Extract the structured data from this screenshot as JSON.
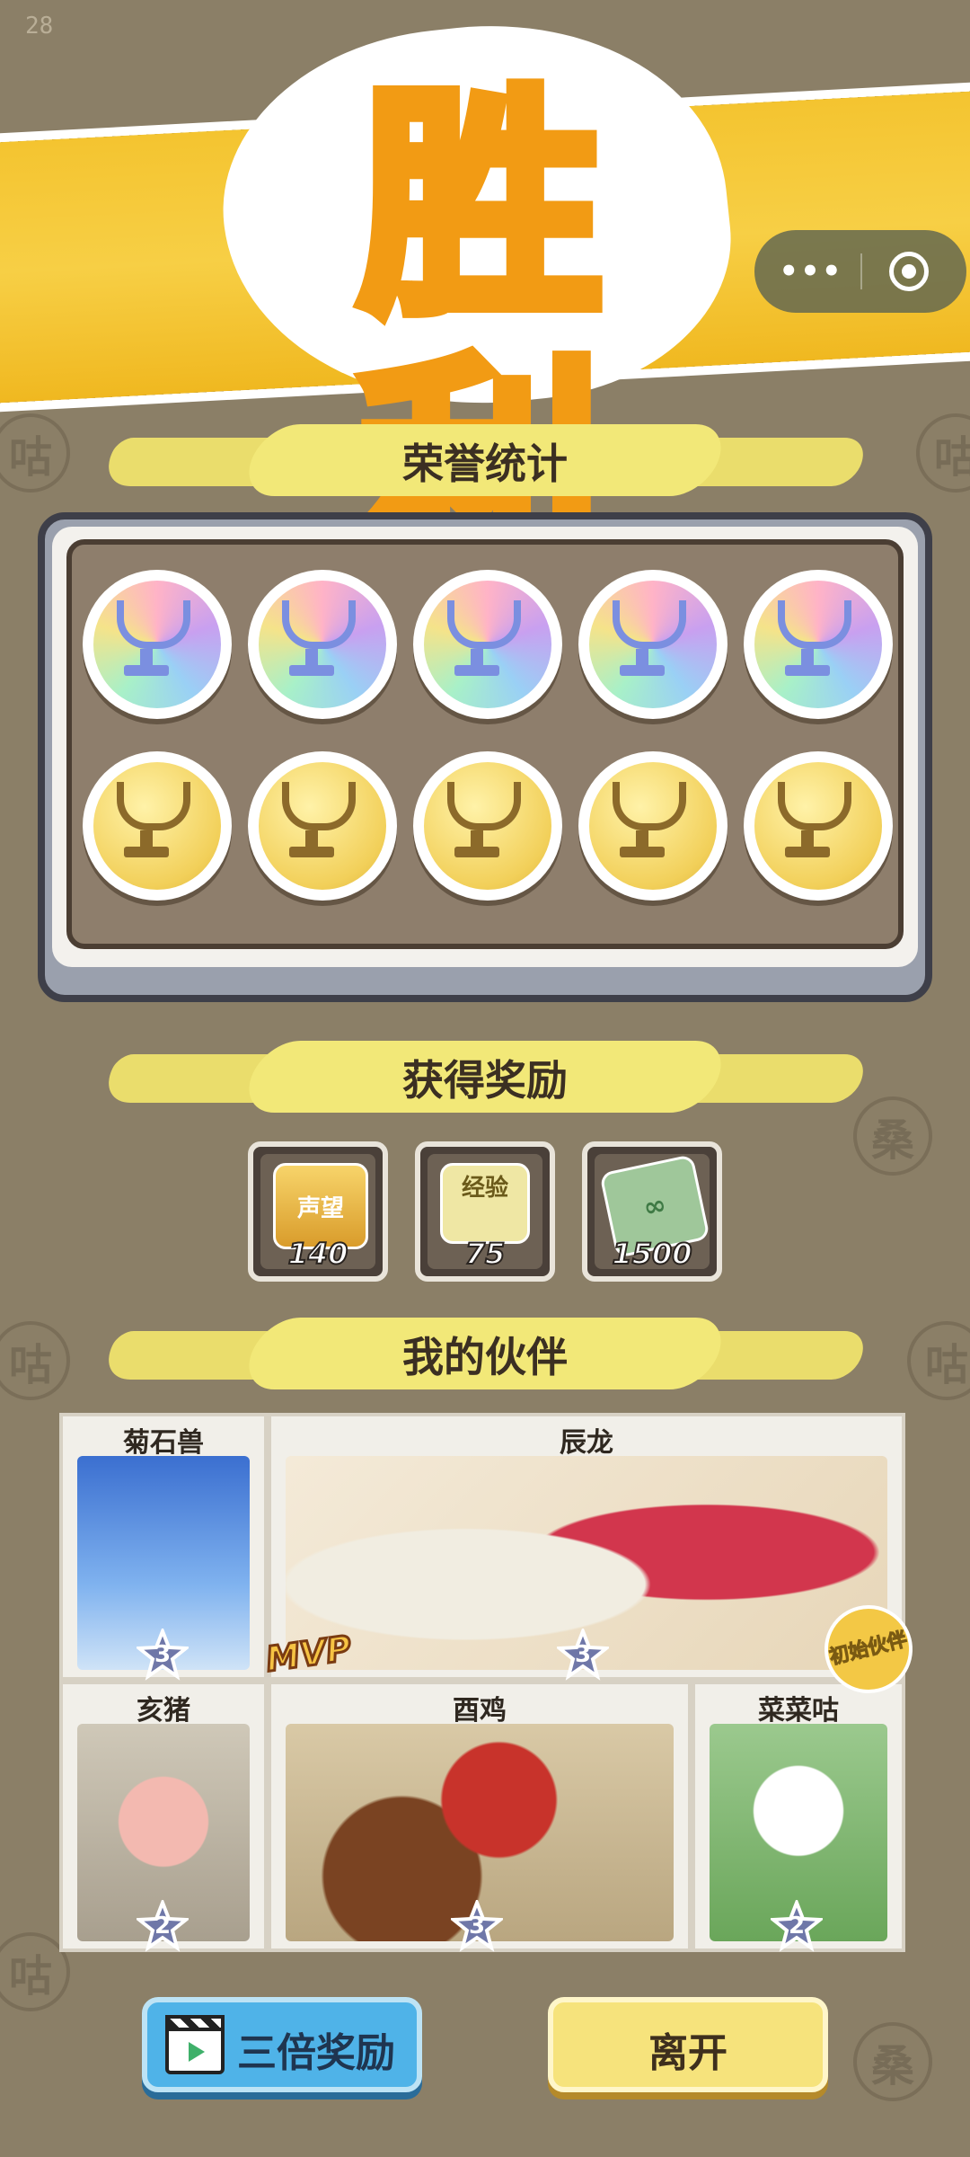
{
  "status": {
    "fps": "28"
  },
  "banner": {
    "title": "胜利"
  },
  "sections": {
    "honor": "荣誉统计",
    "rewards": "获得奖励",
    "partners": "我的伙伴"
  },
  "honor": {
    "medals": [
      {
        "type": "rainbow"
      },
      {
        "type": "rainbow"
      },
      {
        "type": "rainbow"
      },
      {
        "type": "rainbow"
      },
      {
        "type": "rainbow"
      },
      {
        "type": "gold"
      },
      {
        "type": "gold"
      },
      {
        "type": "gold"
      },
      {
        "type": "gold"
      },
      {
        "type": "gold"
      }
    ]
  },
  "rewards": [
    {
      "icon": "reputation-badge-icon",
      "tag": "声望",
      "count": "140"
    },
    {
      "icon": "experience-dino-icon",
      "tag": "经验",
      "count": "75"
    },
    {
      "icon": "banknote-icon",
      "tag": "",
      "count": "1500"
    }
  ],
  "partners": [
    {
      "name": "菊石兽",
      "level": "3"
    },
    {
      "name": "辰龙",
      "level": "3",
      "mvp": "MVP",
      "badge": "初始伙伴"
    },
    {
      "name": "亥猪",
      "level": "2"
    },
    {
      "name": "酉鸡",
      "level": "3"
    },
    {
      "name": "菜菜咕",
      "level": "2"
    }
  ],
  "buttons": {
    "triple": "三倍奖励",
    "leave": "离开"
  },
  "colors": {
    "background": "#8b7f67",
    "banner": "#f4c430",
    "title_stroke": "#f29b14",
    "triple_button": "#4fb3e8",
    "leave_button": "#f6e37c"
  }
}
